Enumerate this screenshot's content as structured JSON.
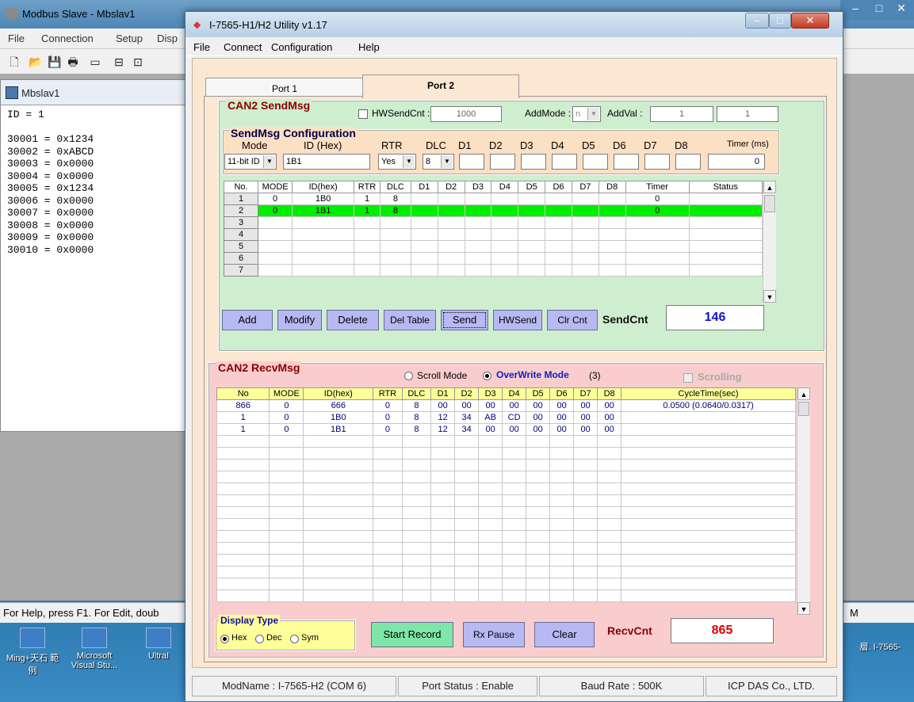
{
  "back_window": {
    "title": "Modbus Slave - Mbslav1",
    "menu": [
      "File",
      "Connection",
      "Setup",
      "Disp"
    ],
    "child_title": "Mbslav1",
    "lines": [
      "ID = 1",
      "",
      "30001 = 0x1234",
      "30002 = 0xABCD",
      "30003 = 0x0000",
      "30004 = 0x0000",
      "30005 = 0x1234",
      "30006 = 0x0000",
      "30007 = 0x0000",
      "30008 = 0x0000",
      "30009 = 0x0000",
      "30010 = 0x0000"
    ],
    "status": "For Help, press F1.  For Edit, doub",
    "status_right": "M"
  },
  "desktop_icons": [
    {
      "label": "Ming+天石\n範例"
    },
    {
      "label": "Microsoft\nVisual Stu..."
    },
    {
      "label": "UltraI"
    }
  ],
  "desktop_right_text": "層. I-7565-",
  "window": {
    "title": "I-7565-H1/H2 Utility v1.17",
    "menu": [
      "File",
      "Connect",
      "Configuration",
      "Help"
    ],
    "tabs": [
      "Port 1",
      "Port 2"
    ]
  },
  "send": {
    "title": "CAN2 SendMsg",
    "hwsendcnt_label": "HWSendCnt :",
    "hwsendcnt_value": "1000",
    "addmode_label": "AddMode :",
    "addmode_value": "n",
    "addval_label": "AddVal :",
    "addval_1": "1",
    "addval_2": "1",
    "config_title": "SendMsg Configuration",
    "labels": {
      "mode": "Mode",
      "id": "ID (Hex)",
      "rtr": "RTR",
      "dlc": "DLC",
      "d1": "D1",
      "d2": "D2",
      "d3": "D3",
      "d4": "D4",
      "d5": "D5",
      "d6": "D6",
      "d7": "D7",
      "d8": "D8",
      "timer": "Timer (ms)"
    },
    "values": {
      "mode": "11-bit ID",
      "id": "1B1",
      "rtr": "Yes",
      "dlc": "8",
      "timer": "0"
    },
    "columns": [
      "No.",
      "MODE",
      "ID(hex)",
      "RTR",
      "DLC",
      "D1",
      "D2",
      "D3",
      "D4",
      "D5",
      "D6",
      "D7",
      "D8",
      "Timer",
      "Status"
    ],
    "rows": [
      [
        "1",
        "0",
        "1B0",
        "1",
        "8",
        "",
        "",
        "",
        "",
        "",
        "",
        "",
        "",
        "0",
        ""
      ],
      [
        "2",
        "0",
        "1B1",
        "1",
        "8",
        "",
        "",
        "",
        "",
        "",
        "",
        "",
        "",
        "0",
        ""
      ],
      [
        "3",
        "",
        "",
        "",
        "",
        "",
        "",
        "",
        "",
        "",
        "",
        "",
        "",
        "",
        ""
      ],
      [
        "4",
        "",
        "",
        "",
        "",
        "",
        "",
        "",
        "",
        "",
        "",
        "",
        "",
        "",
        ""
      ],
      [
        "5",
        "",
        "",
        "",
        "",
        "",
        "",
        "",
        "",
        "",
        "",
        "",
        "",
        "",
        ""
      ],
      [
        "6",
        "",
        "",
        "",
        "",
        "",
        "",
        "",
        "",
        "",
        "",
        "",
        "",
        "",
        ""
      ],
      [
        "7",
        "",
        "",
        "",
        "",
        "",
        "",
        "",
        "",
        "",
        "",
        "",
        "",
        "",
        ""
      ]
    ],
    "buttons": {
      "add": "Add",
      "modify": "Modify",
      "delete": "Delete",
      "deltable": "Del Table",
      "send": "Send",
      "hwsend": "HWSend",
      "clrcnt": "Clr Cnt"
    },
    "sendcnt_label": "SendCnt",
    "sendcnt_value": "146"
  },
  "recv": {
    "title": "CAN2 RecvMsg",
    "scroll_mode": "Scroll Mode",
    "overwrite_mode": "OverWrite Mode",
    "overwrite_count": "(3)",
    "scrolling": "Scrolling",
    "columns": [
      "No",
      "MODE",
      "ID(hex)",
      "RTR",
      "DLC",
      "D1",
      "D2",
      "D3",
      "D4",
      "D5",
      "D6",
      "D7",
      "D8",
      "CycleTime(sec)"
    ],
    "rows": [
      [
        "866",
        "0",
        "666",
        "0",
        "8",
        "00",
        "00",
        "00",
        "00",
        "00",
        "00",
        "00",
        "00",
        "0.0500 (0.0640/0.0317)"
      ],
      [
        "1",
        "0",
        "1B0",
        "0",
        "8",
        "12",
        "34",
        "AB",
        "CD",
        "00",
        "00",
        "00",
        "00",
        ""
      ],
      [
        "1",
        "0",
        "1B1",
        "0",
        "8",
        "12",
        "34",
        "00",
        "00",
        "00",
        "00",
        "00",
        "00",
        ""
      ]
    ],
    "display_type": "Display Type",
    "radio_hex": "Hex",
    "radio_dec": "Dec",
    "radio_sym": "Sym",
    "buttons": {
      "start": "Start Record",
      "pause": "Rx Pause",
      "clear": "Clear"
    },
    "recvcnt_label": "RecvCnt",
    "recvcnt_value": "865"
  },
  "statusbar": [
    "ModName : I-7565-H2 (COM 6)",
    "Port Status : Enable",
    "Baud Rate : 500K",
    "ICP DAS Co., LTD."
  ],
  "colors": {
    "send_bg": "#cfeecf",
    "recv_bg": "#f9cdcd",
    "client_bg": "#fce7d2",
    "selected_row": "#00ee00",
    "count_red": "#e00000",
    "count_blue": "#1010d0"
  }
}
